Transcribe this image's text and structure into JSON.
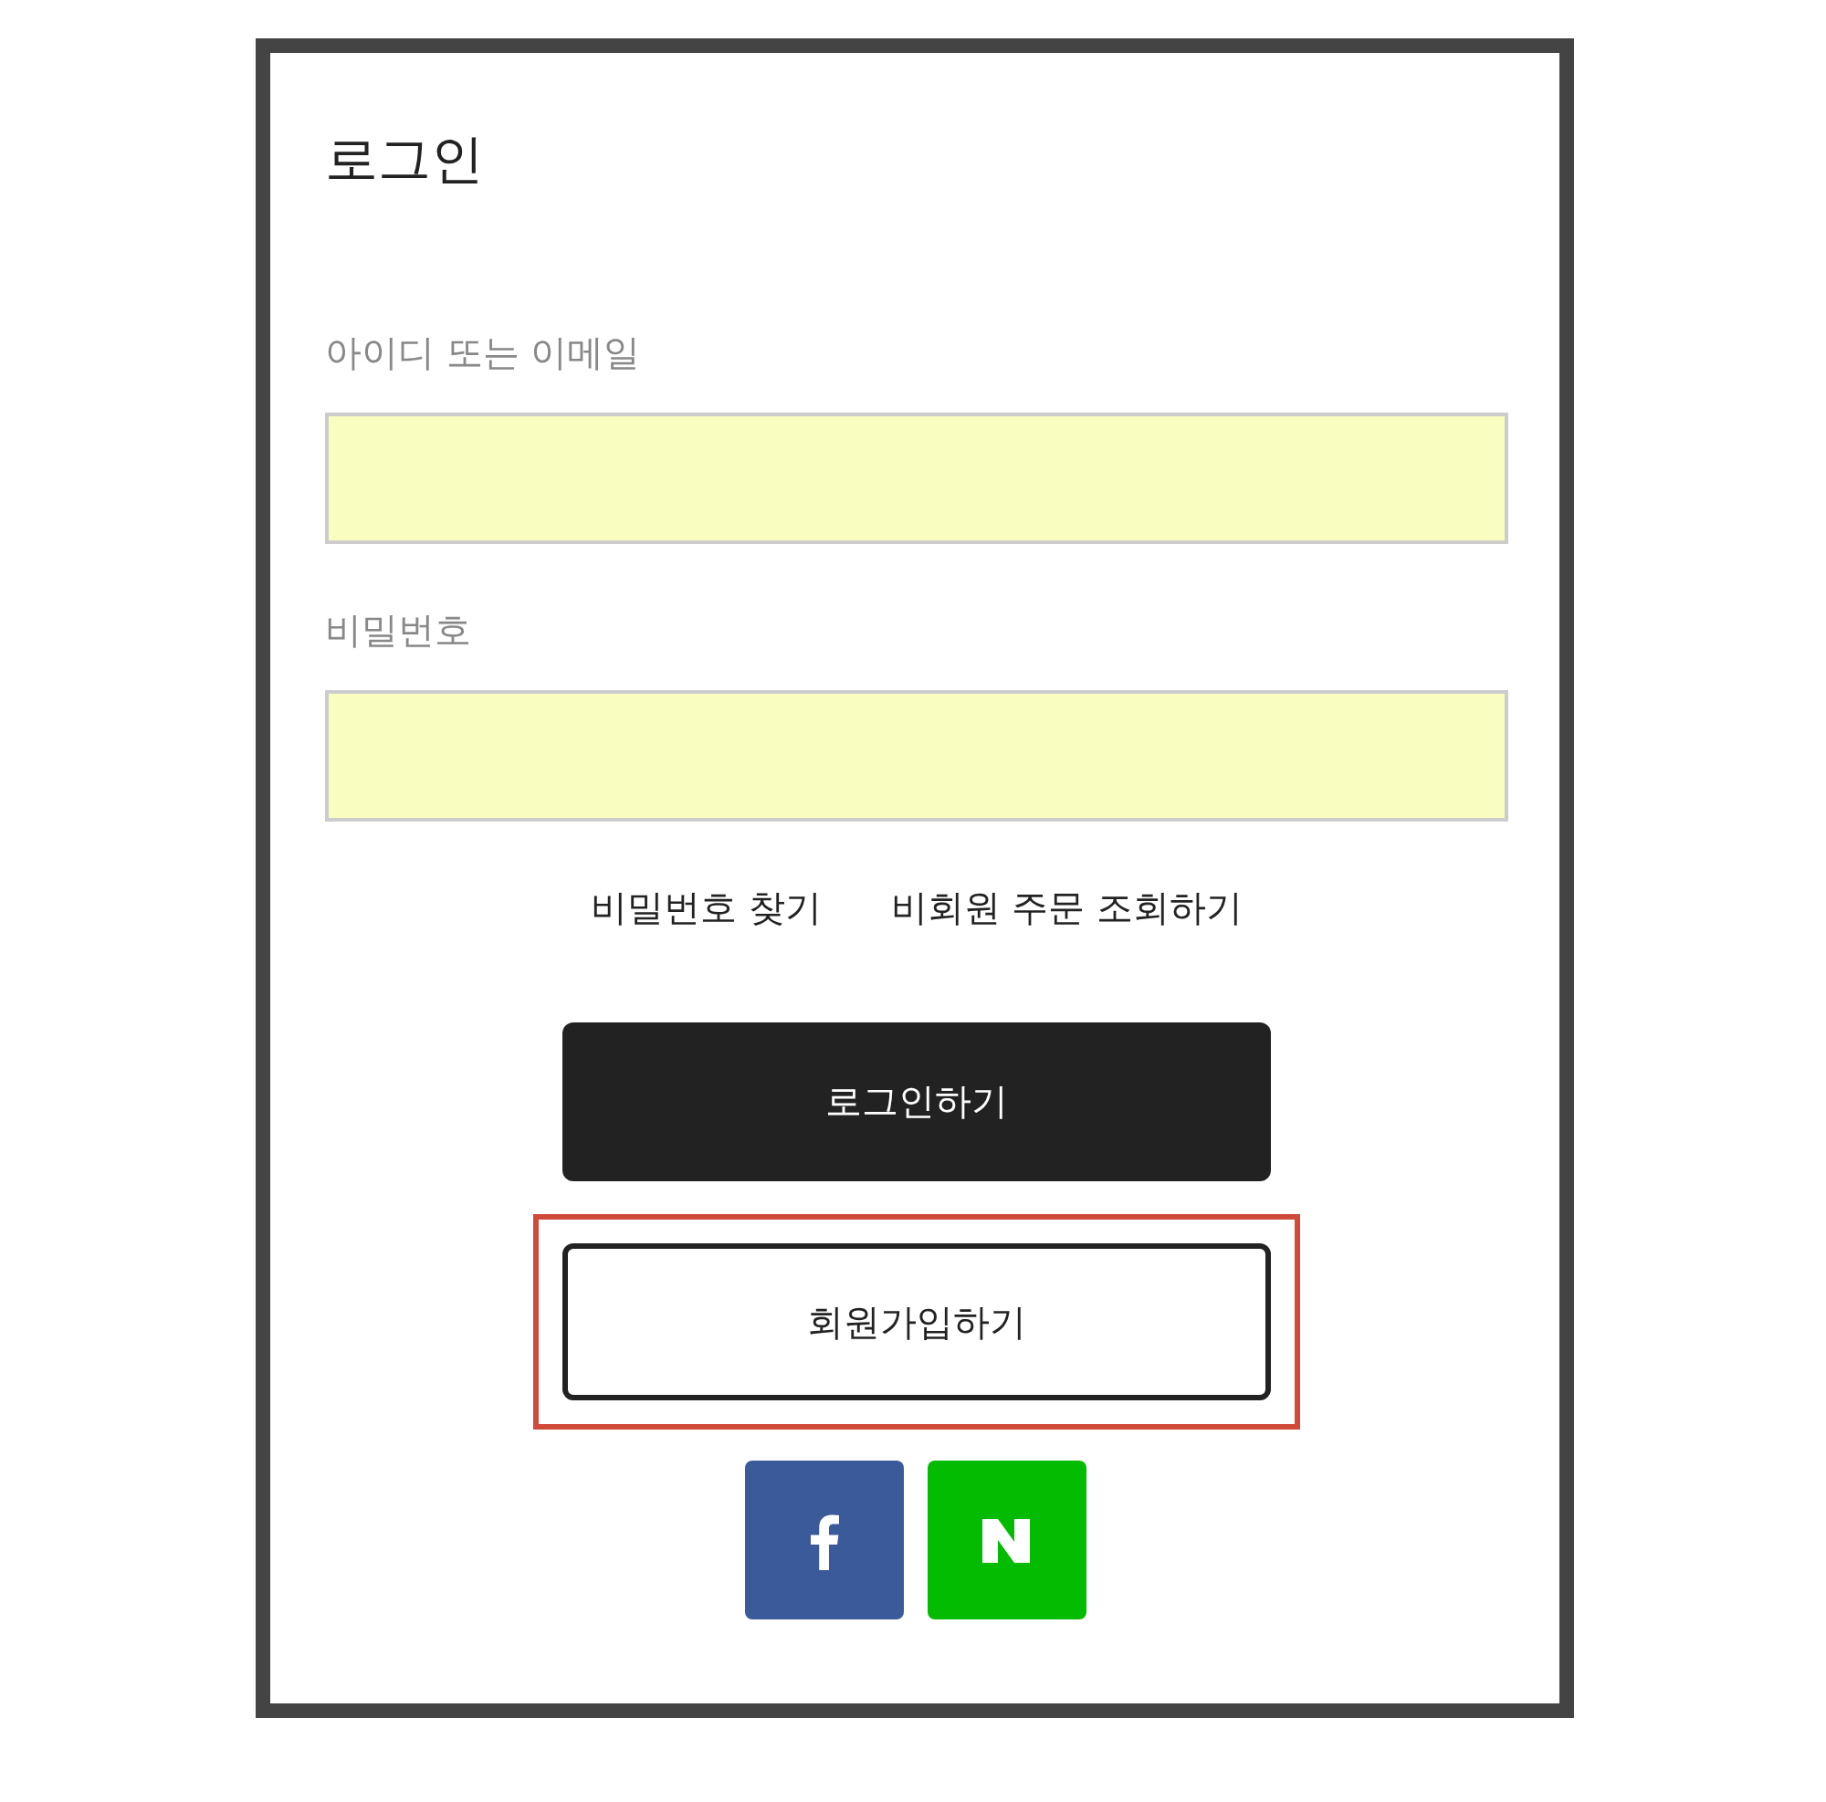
{
  "title": "로그인",
  "fields": [
    {
      "label": "아이디 또는 이메일"
    },
    {
      "label": "비밀번호"
    }
  ],
  "links": [
    "비밀번호 찾기",
    "비회원 주문 조회하기"
  ],
  "login_button": {
    "label": "로그인하기"
  },
  "signup_button": {
    "label": "회원가입하기",
    "highlighted": true
  },
  "social_buttons": [
    {
      "kind": "facebook"
    },
    {
      "kind": "naver"
    }
  ]
}
